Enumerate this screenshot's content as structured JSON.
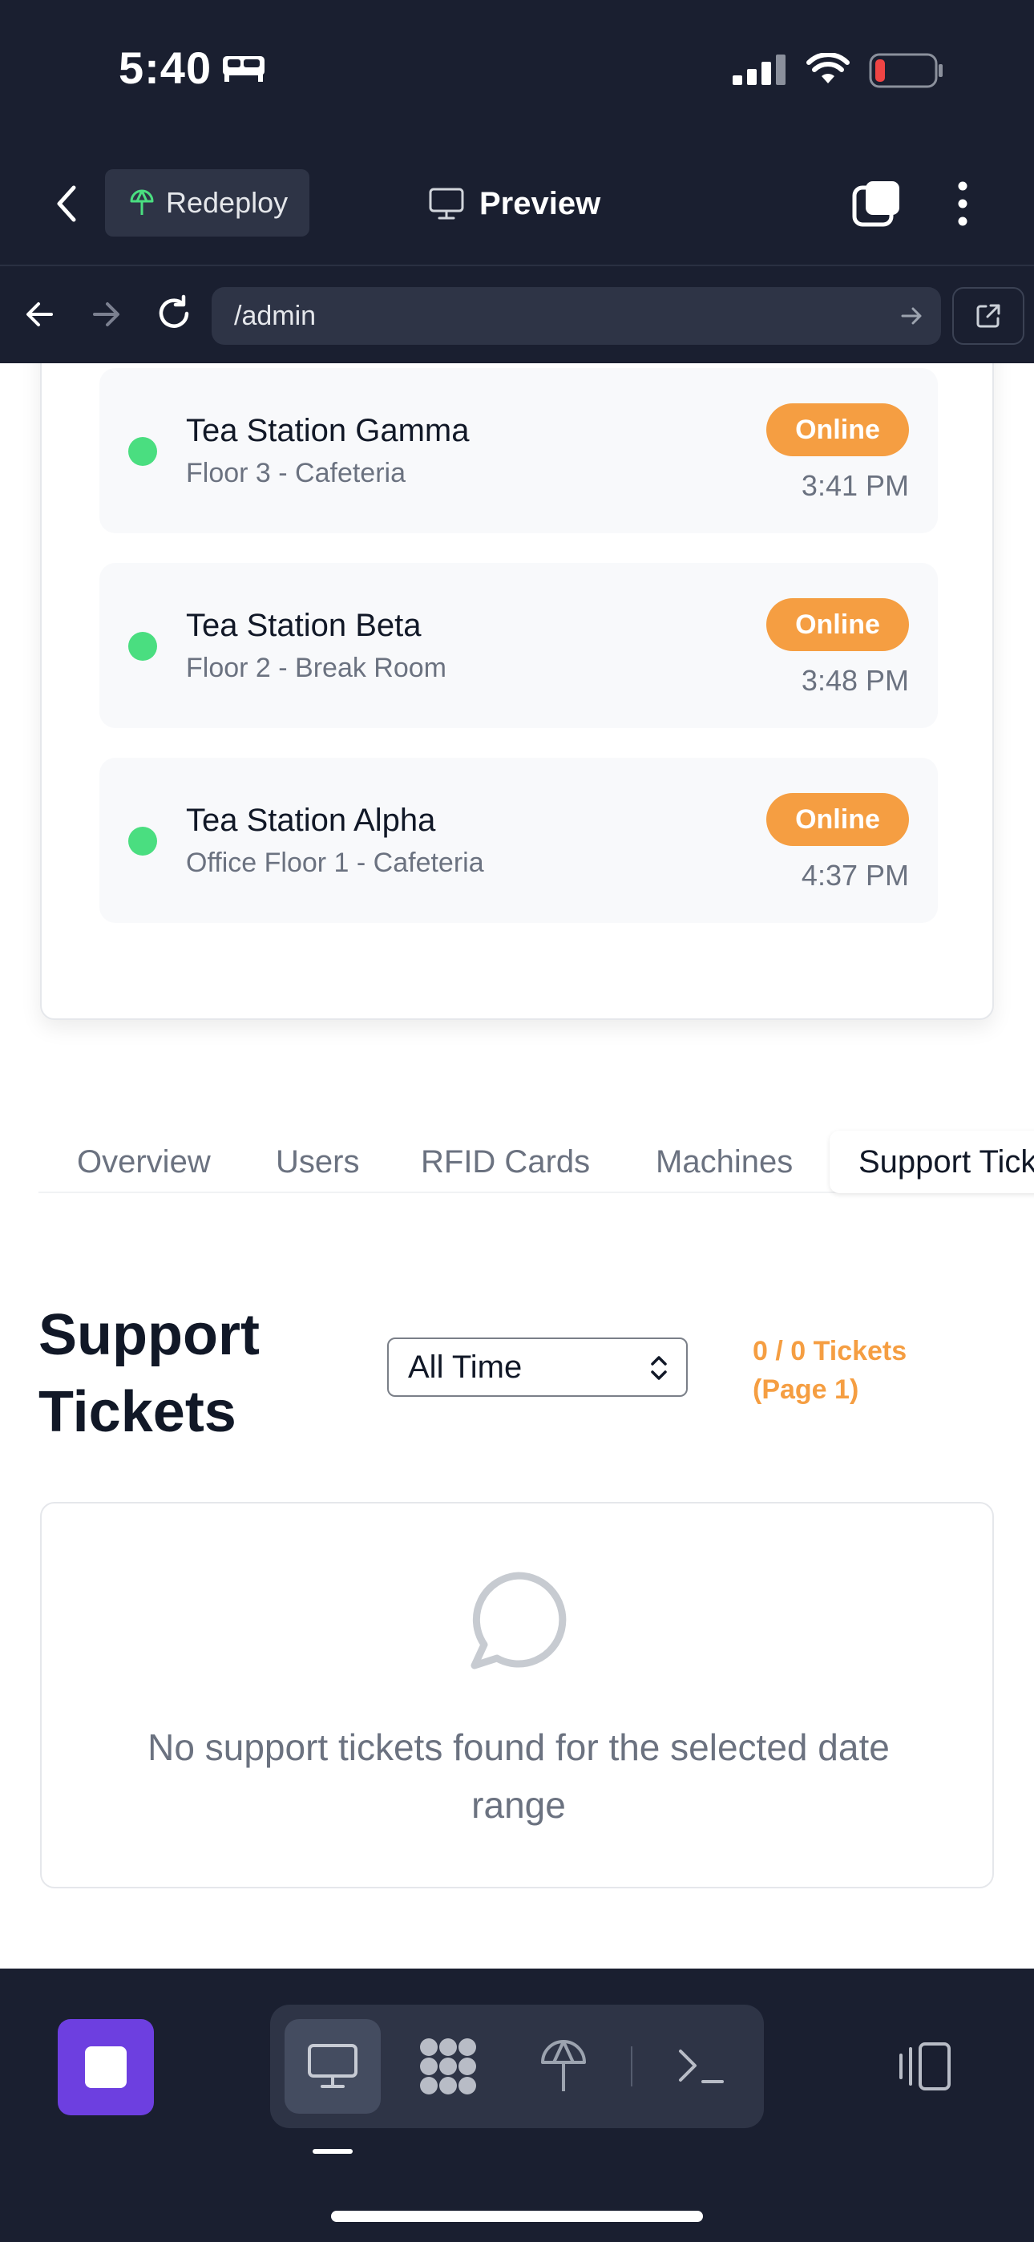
{
  "status_bar": {
    "time": "5:40"
  },
  "header": {
    "redeploy_label": "Redeploy",
    "preview_label": "Preview"
  },
  "browser": {
    "url": "/admin"
  },
  "machines": [
    {
      "name": "Tea Station Gamma",
      "location": "Floor 3 - Cafeteria",
      "status": "Online",
      "time": "3:41 PM"
    },
    {
      "name": "Tea Station Beta",
      "location": "Floor 2 - Break Room",
      "status": "Online",
      "time": "3:48 PM"
    },
    {
      "name": "Tea Station Alpha",
      "location": "Office Floor 1 - Cafeteria",
      "status": "Online",
      "time": "4:37 PM"
    }
  ],
  "tabs": [
    {
      "label": "Overview"
    },
    {
      "label": "Users"
    },
    {
      "label": "RFID Cards"
    },
    {
      "label": "Machines"
    },
    {
      "label": "Support Tickets"
    }
  ],
  "support": {
    "title": "Support Tickets",
    "filter_value": "All Time",
    "count_text": "0 / 0 Tickets (Page 1)",
    "empty_text": "No support tickets found for the selected date range"
  },
  "colors": {
    "chrome_bg": "#1a1f30",
    "accent_orange": "#f59e42",
    "online_dot": "#4ade80",
    "stop_purple": "#6d3fe0"
  },
  "icons": {
    "status_bar": [
      "bed-icon",
      "signal-icon",
      "wifi-icon",
      "battery-low-icon"
    ],
    "header": [
      "back-icon",
      "redeploy-icon",
      "monitor-icon",
      "tabs-icon",
      "more-vertical-icon"
    ],
    "browser": [
      "arrow-left-icon",
      "arrow-right-icon",
      "reload-icon",
      "go-arrow-icon",
      "external-link-icon"
    ],
    "empty_state": "chat-bubble-icon",
    "dock": [
      "stop-icon",
      "preview-monitor-icon",
      "apps-grid-icon",
      "deploy-icon",
      "terminal-icon",
      "device-toggle-icon"
    ]
  }
}
